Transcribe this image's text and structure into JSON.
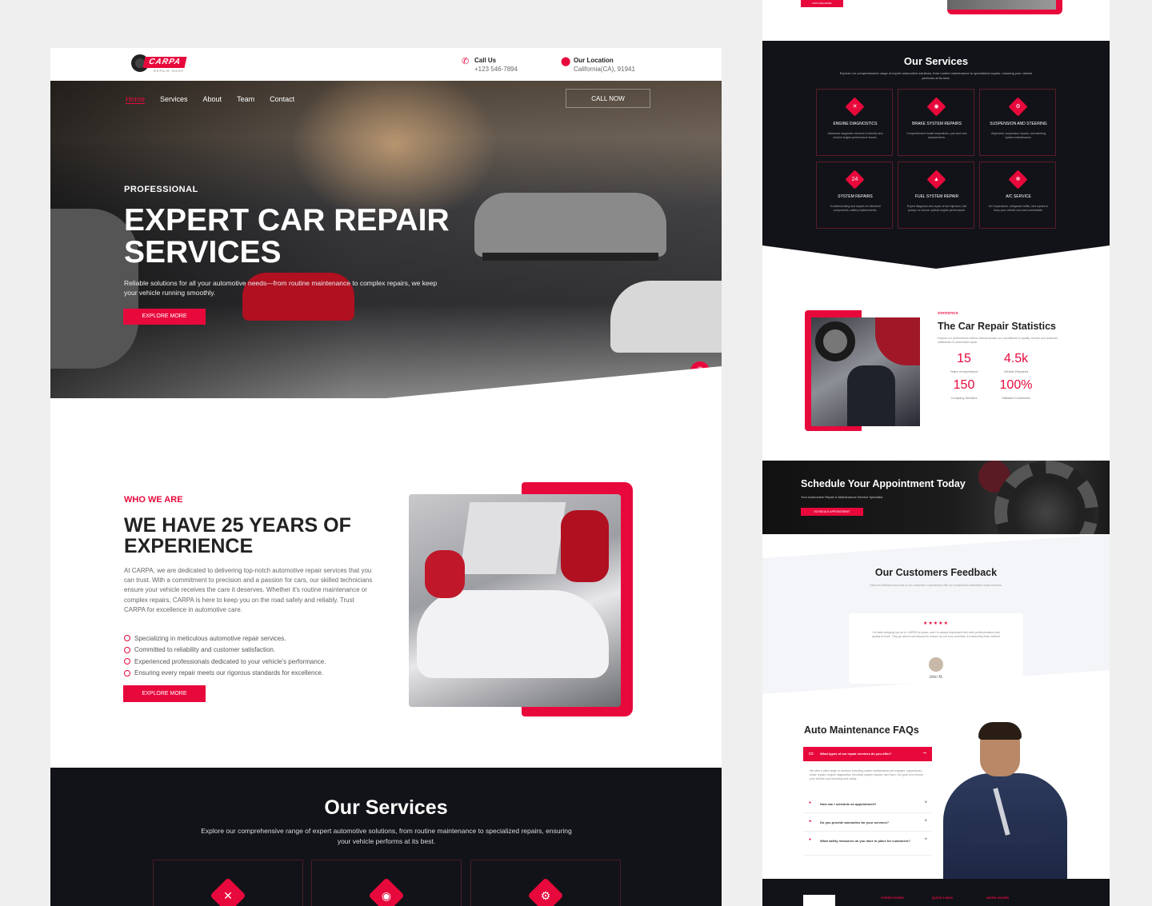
{
  "brand": {
    "logo_text": "CARPA",
    "logo_sub": "REPAIR SHOP",
    "accent": "#e8093c",
    "dark": "#121318"
  },
  "topbar": {
    "call_label": "Call Us",
    "call_value": "+123 546-7894",
    "location_label": "Our Location",
    "location_value": "California(CA), 91941"
  },
  "nav": {
    "items": [
      "Home",
      "Services",
      "About",
      "Team",
      "Contact"
    ],
    "active": "Home",
    "cta": "CALL NOW"
  },
  "hero": {
    "kicker": "PROFESSIONAL",
    "title": "EXPERT CAR REPAIR SERVICES",
    "description": "Reliable solutions for all your automotive needs—from routine maintenance to complex repairs, we keep your vehicle running smoothly.",
    "button": "EXPLORE MORE"
  },
  "about": {
    "kicker": "WHO WE ARE",
    "title": "WE HAVE 25 YEARS OF EXPERIENCE",
    "description": "At CARPA, we are dedicated to delivering top-notch automotive repair services that you can trust. With a commitment to precision and a passion for cars, our skilled technicians ensure your vehicle receives the care it deserves. Whether it's routine maintenance or complex repairs, CARPA is here to keep you on the road safely and reliably. Trust CARPA for excellence in automotive care.",
    "points": [
      "Specializing in meticulous automotive repair services.",
      "Committed to reliability and customer satisfaction.",
      "Experienced professionals dedicated to your vehicle's performance.",
      "Ensuring every repair meets our rigorous standards for excellence."
    ],
    "button": "EXPLORE MORE"
  },
  "services": {
    "title": "Our Services",
    "description": "Explore our comprehensive range of expert automotive solutions, from routine maintenance to specialized repairs, ensuring your vehicle performs at its best.",
    "items": [
      {
        "title": "ENGINE DIAGNOSTICS",
        "desc": "Advanced diagnostic services to identify and resolve engine performance issues.",
        "icon": "wrench-icon"
      },
      {
        "title": "BRAKE SYSTEM REPAIRS",
        "desc": "Comprehensive brake inspections, pad and rotor replacements.",
        "icon": "brake-icon"
      },
      {
        "title": "SUSPENSION AND STEERING",
        "desc": "Alignment, suspension repairs, and steering system maintenance.",
        "icon": "gear-icon"
      },
      {
        "title": "SYSTEM REPAIRS",
        "desc": "Troubleshooting and repairs for electrical components, battery replacements.",
        "icon": "clock-24-icon"
      },
      {
        "title": "FUEL SYSTEM REPAIR",
        "desc": "Expert diagnosis and repair of fuel injection, fuel pumps, to ensure optimal engine performance.",
        "icon": "fuel-icon"
      },
      {
        "title": "A/C SERVICE",
        "desc": "A/C inspections, refrigerant refills, and repairs to keep your vehicle cool and comfortable.",
        "icon": "ac-icon"
      }
    ]
  },
  "stats": {
    "kicker": "STATISTICS",
    "title": "The Car Repair Statistics",
    "description": "Explore our performance metrics that showcase our commitment to quality, service and customer satisfaction in automotive repair.",
    "items": [
      {
        "value": "15",
        "label": "Years of experience"
      },
      {
        "value": "4.5k",
        "label": "Vehicle Repaired"
      },
      {
        "value": "150",
        "label": "Company Workers"
      },
      {
        "value": "100%",
        "label": "Satisfied Customers"
      }
    ]
  },
  "appointment": {
    "title": "Schedule Your Appointment Today",
    "description": "Your Automotive Repair & Maintenance Service Specialist",
    "button": "SCHEDULE APPOINTMENT"
  },
  "feedback": {
    "title": "Our Customers Feedback",
    "description": "Discover firsthand accounts of our customers' experiences with our exceptional automotive repair services.",
    "stars": "★★★★★",
    "quote": "I've been bringing my car to CARPA for years, and I'm always impressed with their professionalism and quality of work. They go above and beyond to ensure my car runs smoothly. A trustworthy team indeed!",
    "name": "John M."
  },
  "faq": {
    "title": "Auto Maintenance FAQs",
    "open_question": "What types of car repair services do you offer?",
    "open_answer": "We offer a wide range of services including routine maintenance (oil changes, inspections), brake repairs, engine diagnostics, electrical system repairs, and more. Our goal is to ensure your vehicle runs smoothly and safely.",
    "questions": [
      "How can I schedule an appointment?",
      "Do you provide warranties for your services?",
      "What safety measures do you have in place for customers?"
    ]
  },
  "footer": {
    "cols": [
      "OTHER PAGES",
      "QUICK LINKS",
      "WORK HOURS"
    ],
    "top_button": "EXPLORE MORE"
  }
}
